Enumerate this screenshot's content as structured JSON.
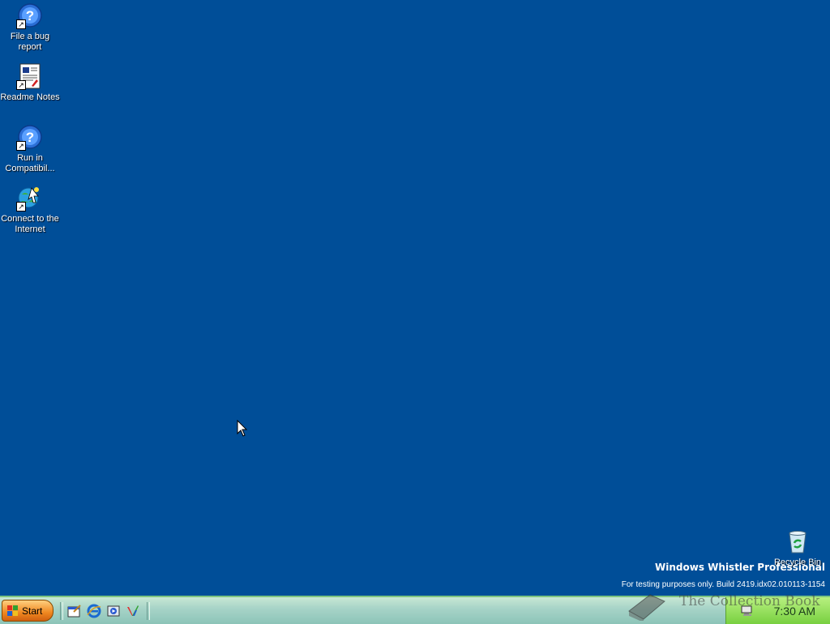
{
  "desktop": {
    "icons": [
      {
        "label": "File a bug report",
        "icon": "help-shortcut-icon"
      },
      {
        "label": "Readme Notes",
        "icon": "document-icon"
      },
      {
        "label": "Run in Compatibil...",
        "icon": "help-shortcut-icon"
      },
      {
        "label": "Connect to the Internet",
        "icon": "connect-internet-icon"
      }
    ],
    "recycle_bin": {
      "label": "Recycle Bin",
      "icon": "recycle-bin-icon"
    },
    "background_color": "#004e98"
  },
  "watermark": {
    "title": "Windows Whistler Professional",
    "build": "For testing purposes only. Build 2419.idx02.010113-1154"
  },
  "taskbar": {
    "start_label": "Start",
    "quick_launch": [
      "show-desktop-icon",
      "internet-explorer-icon",
      "media-player-icon",
      "msn-icon"
    ],
    "clock": "7:30 AM"
  },
  "brand_overlay": "The Collection Book"
}
